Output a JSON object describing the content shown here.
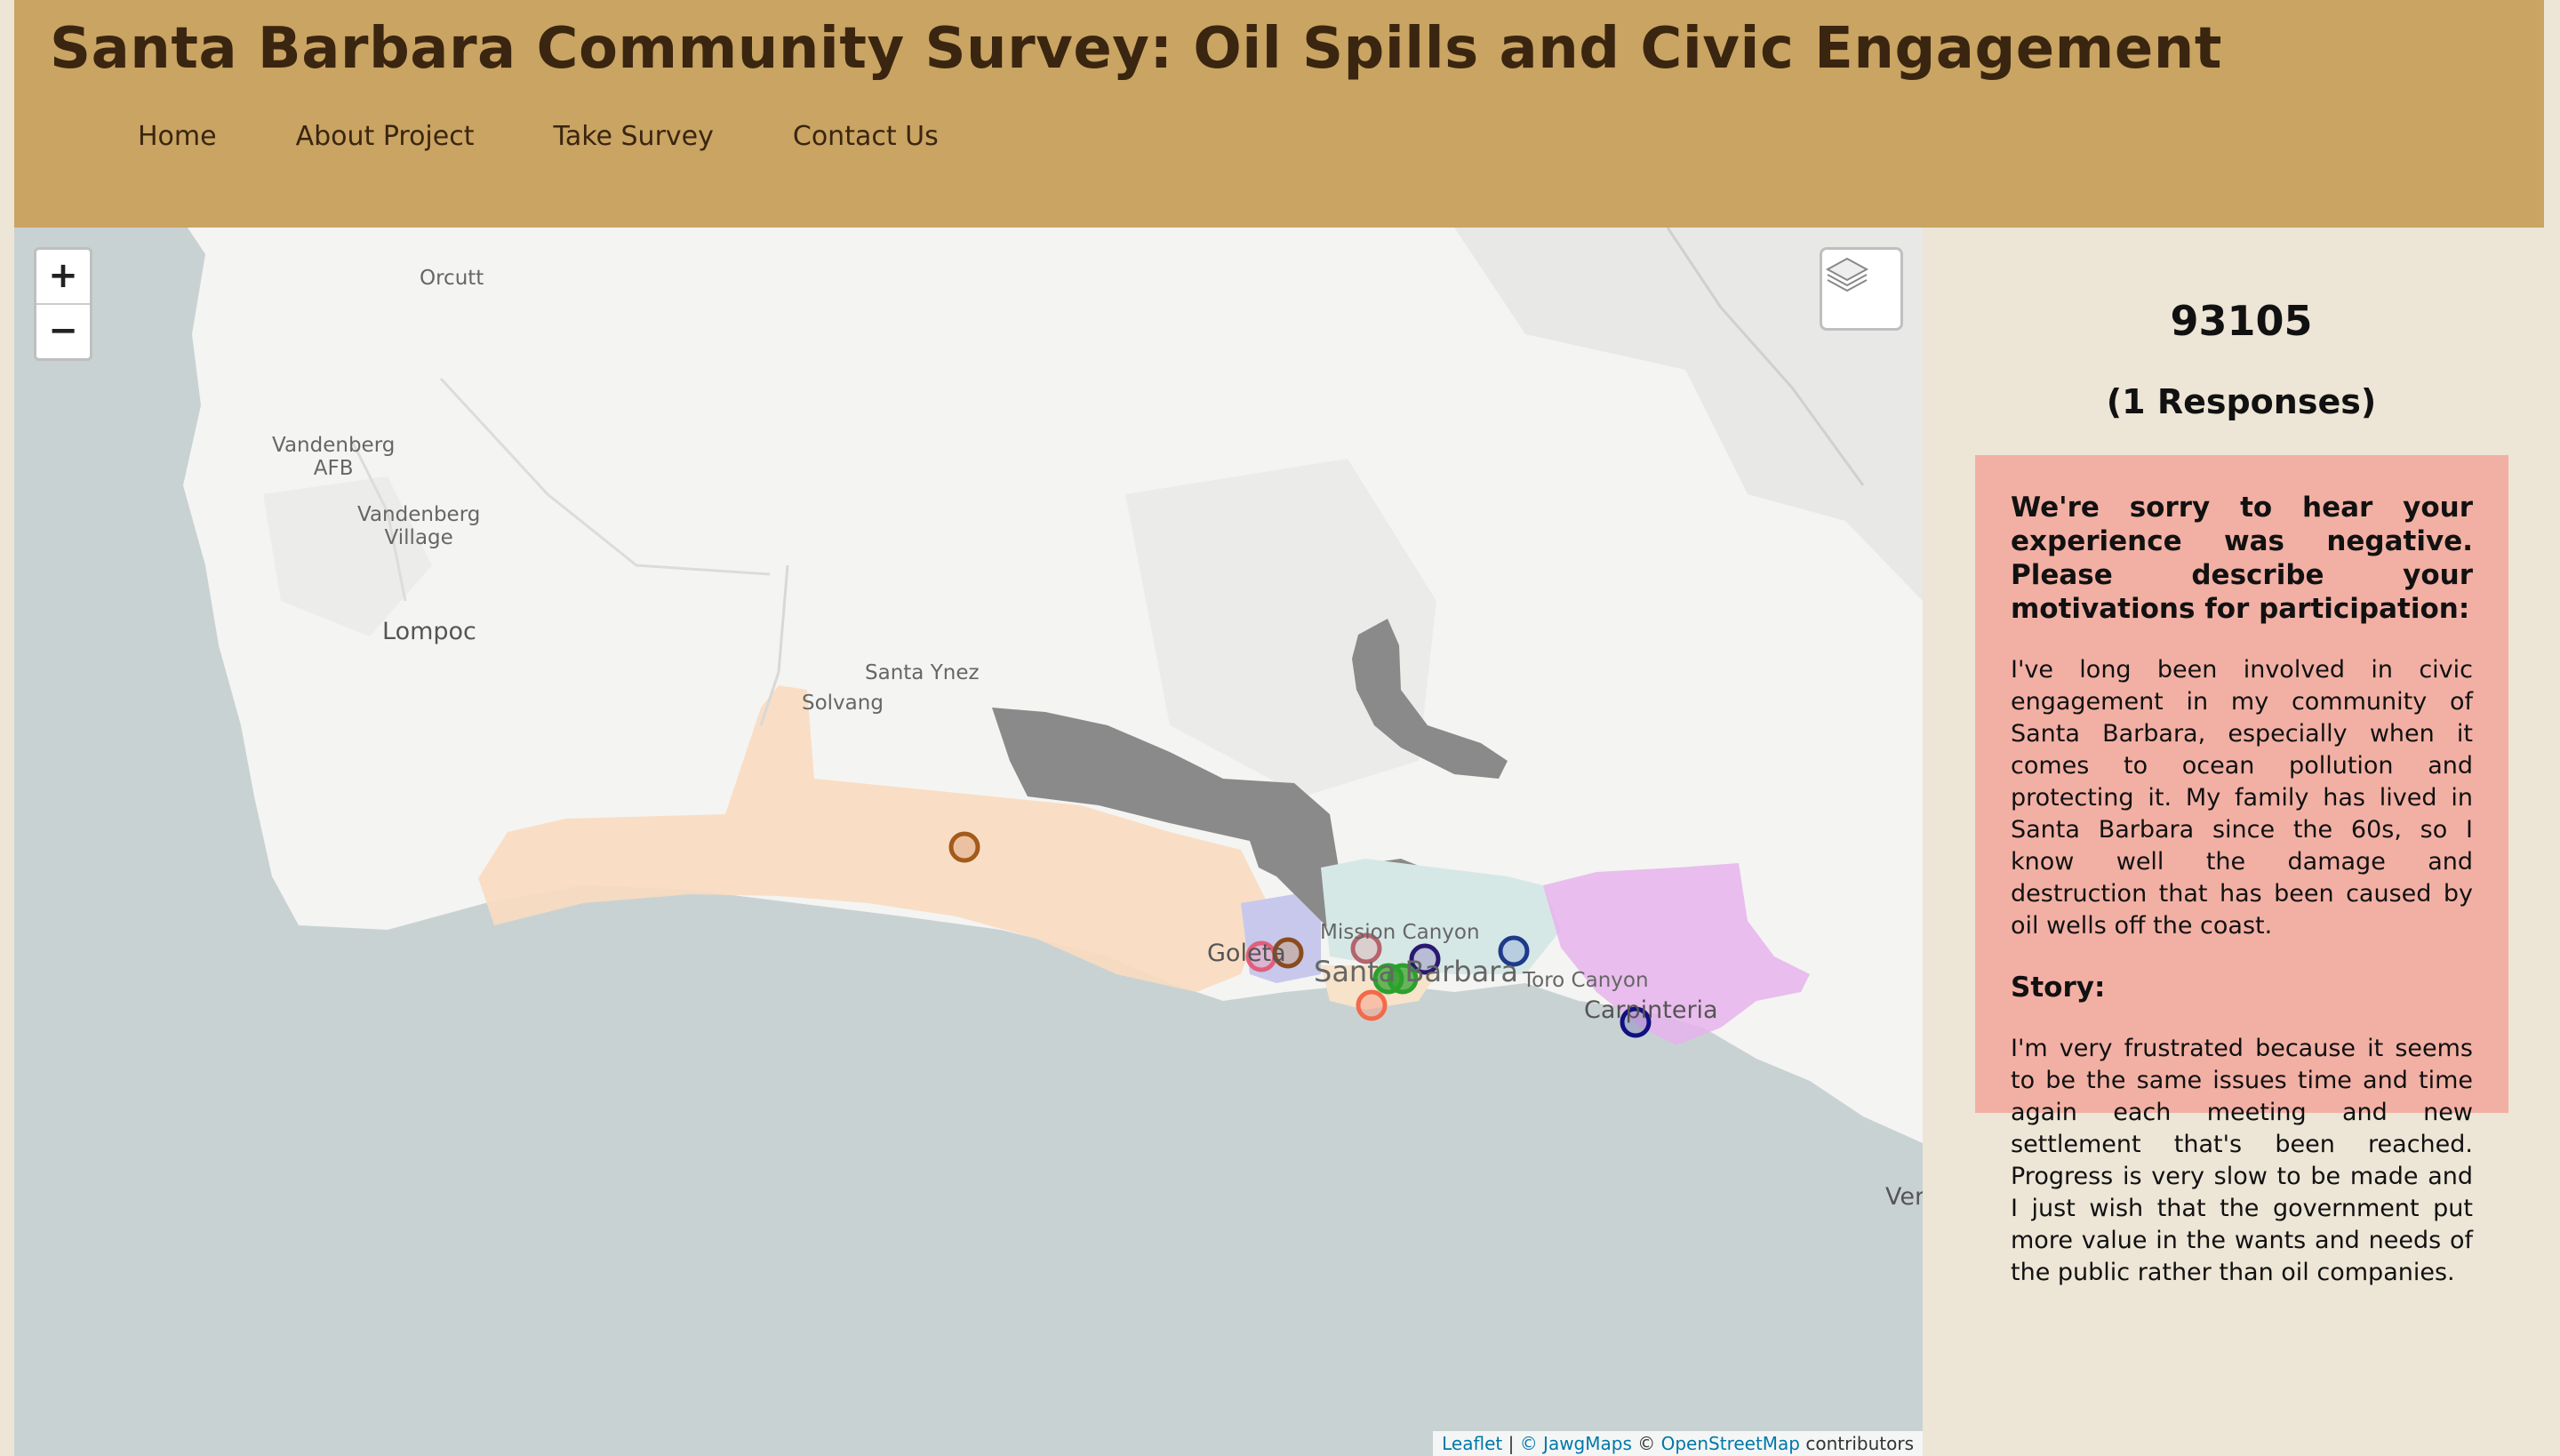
{
  "header": {
    "title": "Santa Barbara Community Survey: Oil Spills and Civic Engagement",
    "nav": [
      "Home",
      "About Project",
      "Take Survey",
      "Contact Us"
    ]
  },
  "map": {
    "zoom_in": "+",
    "zoom_out": "−",
    "layers_icon": "layers-icon",
    "places": {
      "orcutt": "Orcutt",
      "vandenberg_afb": "Vandenberg\nAFB",
      "vandenberg_village": "Vandenberg\nVillage",
      "lompoc": "Lompoc",
      "santa_ynez": "Santa Ynez",
      "solvang": "Solvang",
      "mission_canyon": "Mission Canyon",
      "goleta": "Goleta",
      "santa_barbara": "Santa Barbara",
      "toro_canyon": "Toro Canyon",
      "carpinteria": "Carpinteria",
      "ventura": "Ver"
    },
    "attribution": {
      "leaflet": "Leaflet",
      "jawg": "© JawgMaps",
      "osm_prefix": "©",
      "osm": "OpenStreetMap",
      "suffix": "contributors"
    },
    "colors": {
      "water": "#c9d2d3",
      "land": "#f4f4f2",
      "zone_orange": "#f9dcc0",
      "zone_gray": "#8a8a8a",
      "zone_pink": "#e6b3ec",
      "zone_blue": "#c7c8ec",
      "zone_teal": "#d6e8e6"
    }
  },
  "sidebar": {
    "zip": "93105",
    "responses": "(1 Responses)",
    "q1_heading": "We're sorry to hear your experience was negative. Please describe your motivations for participation:",
    "q1_answer": "I've long been involved in civic engagement in my community of Santa Barbara, especially when it comes to ocean pollution and protecting it. My family has lived in Santa Barbara since the 60s, so I know well the damage and destruction that has been caused by oil wells off the coast.",
    "q2_heading": "Story:",
    "q2_answer": "I'm very frustrated because it seems to be the same issues time and time again each meeting and new settlement that's been reached. Progress is very slow to be made and I just wish that the government put more value in the wants and needs of the public rather than oil companies."
  }
}
